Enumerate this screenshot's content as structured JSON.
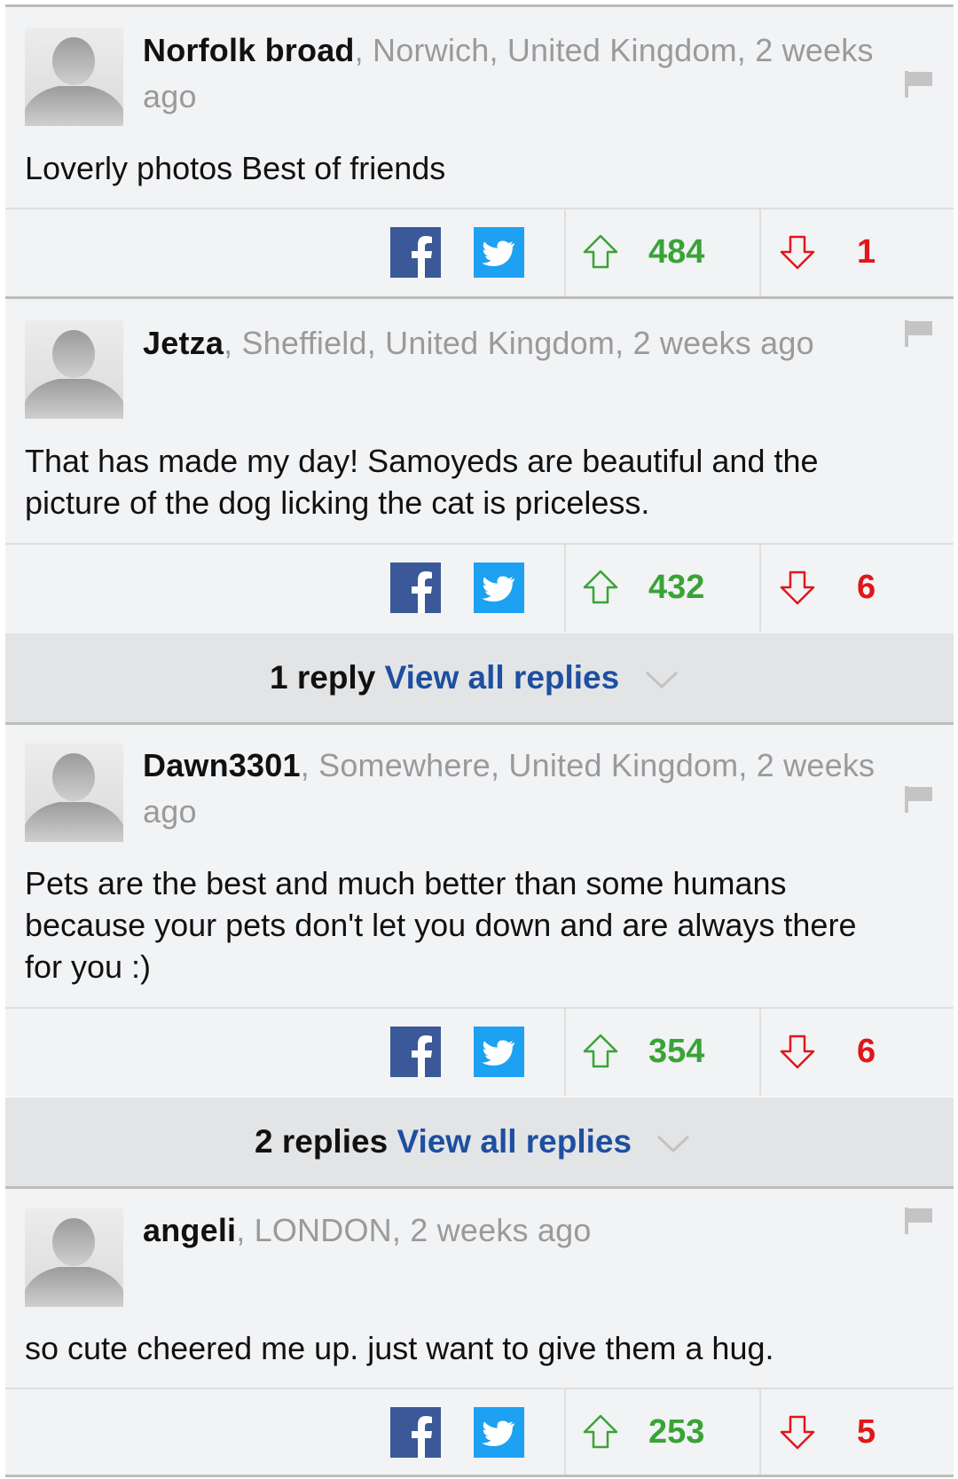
{
  "comments": [
    {
      "username": "Norfolk broad",
      "meta_line1": ", Norwich, United Kingdom, 2 weeks",
      "meta_line2": "ago",
      "text": "Loverly photos Best of friends",
      "upvotes": "484",
      "downvotes": "1"
    },
    {
      "username": "Jetza",
      "meta_line1": ", Sheffield, United Kingdom, 2 weeks ago",
      "text_line1": "That has made my day! Samoyeds are beautiful and the",
      "text_line2": "picture of the dog licking the cat is priceless.",
      "upvotes": "432",
      "downvotes": "6",
      "replies_count": "1 reply",
      "replies_link": "View all replies"
    },
    {
      "username": "Dawn3301",
      "meta_line1": ", Somewhere, United Kingdom, 2 weeks",
      "meta_line2": "ago",
      "text_line1": "Pets are the best and much better than some humans",
      "text_line2": "because your pets don't let you down and are always there",
      "text_line3": "for you :)",
      "upvotes": "354",
      "downvotes": "6",
      "replies_count": "2 replies",
      "replies_link": "View all replies"
    },
    {
      "username": "angeli",
      "meta_line1": ", LONDON, 2 weeks ago",
      "text": "so cute cheered me up. just want to give them a hug.",
      "upvotes": "253",
      "downvotes": "5"
    }
  ],
  "colors": {
    "upvote": "#3aa336",
    "downvote": "#e0161b",
    "link": "#1e4fa0",
    "facebook": "#3b5998",
    "twitter": "#1da1f2"
  },
  "icons": {
    "avatar": "default-avatar-icon",
    "flag": "report-flag-icon",
    "share1": "facebook-icon",
    "share2": "twitter-icon",
    "vote_up": "arrow-up-icon",
    "vote_down": "arrow-down-icon",
    "expand": "chevron-down-icon"
  }
}
